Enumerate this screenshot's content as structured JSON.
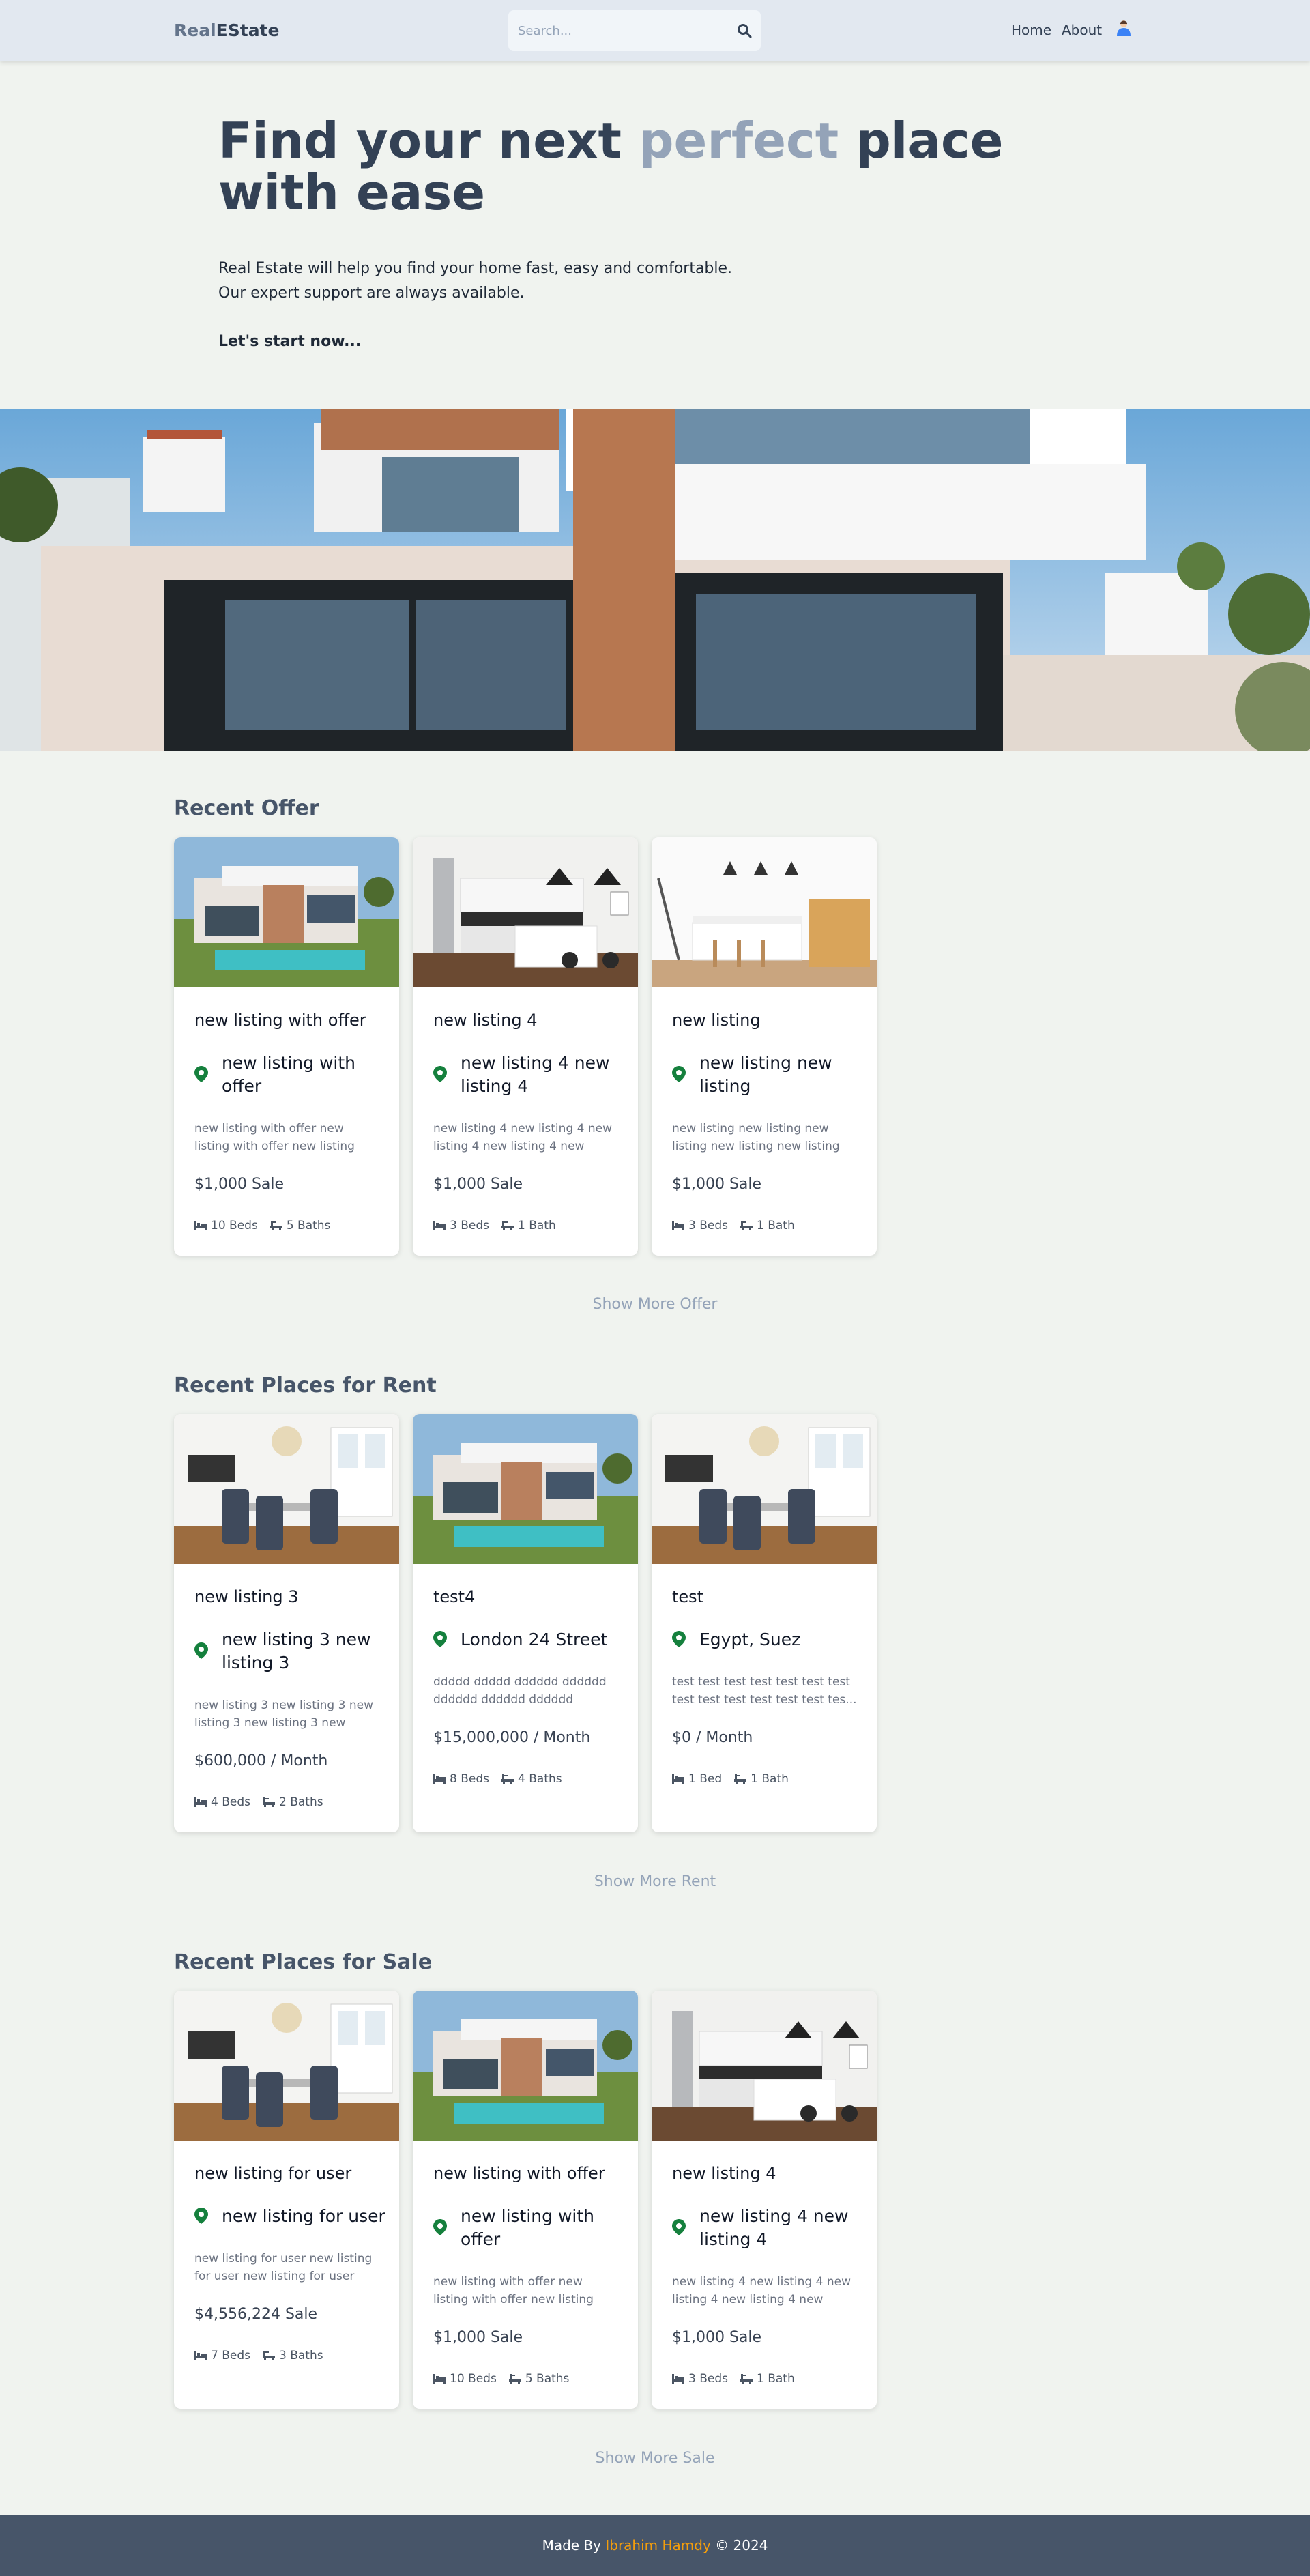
{
  "header": {
    "logo_part1": "Real",
    "logo_part2": "EState",
    "search_placeholder": "Search...",
    "nav": {
      "home": "Home",
      "about": "About"
    }
  },
  "hero": {
    "title_before": "Find your next ",
    "title_highlight": "perfect",
    "title_after": " place with ease",
    "desc_line1": "Real Estate will help you find your home fast, easy and comfortable.",
    "desc_line2": "Our expert support are always available.",
    "cta": "Let's start now..."
  },
  "sections": {
    "offer": {
      "title": "Recent Offer",
      "show_more": "Show More Offer",
      "cards": [
        {
          "title": "new listing with offer",
          "location": "new listing with offer",
          "desc": "new listing with offer new listing with offer new listing with offer...",
          "price": "$1,000 Sale",
          "beds": "10 Beds",
          "baths": "5 Baths",
          "image": "modern-house-pool"
        },
        {
          "title": "new listing 4",
          "location": "new listing 4 new listing 4",
          "desc": "new listing 4 new listing 4 new listing 4 new listing 4 new listing ...",
          "price": "$1,000 Sale",
          "beds": "3 Beds",
          "baths": "1 Bath",
          "image": "white-kitchen"
        },
        {
          "title": "new listing",
          "location": "new listing new listing",
          "desc": "new listing new listing new listing new listing new listing new listin...",
          "price": "$1,000 Sale",
          "beds": "3 Beds",
          "baths": "1 Bath",
          "image": "kitchen-island"
        }
      ]
    },
    "rent": {
      "title": "Recent Places for Rent",
      "show_more": "Show More Rent",
      "cards": [
        {
          "title": "new listing 3",
          "location": "new listing 3 new listing 3",
          "desc": "new listing 3 new listing 3 new listing 3 new listing 3 new listing ...",
          "price": "$600,000 / Month",
          "beds": "4 Beds",
          "baths": "2 Baths",
          "image": "dining-room"
        },
        {
          "title": "test4",
          "location": "London 24 Street",
          "desc": "ddddd ddddd dddddd dddddd dddddd dddddd dddddd ddddd...",
          "price": "$15,000,000 / Month",
          "beds": "8 Beds",
          "baths": "4 Baths",
          "image": "modern-house-pool"
        },
        {
          "title": "test",
          "location": "Egypt, Suez",
          "desc": "test test test test test test test test test test test test test tes...",
          "price": "$0 / Month",
          "beds": "1 Bed",
          "baths": "1 Bath",
          "image": "dining-room"
        }
      ]
    },
    "sale": {
      "title": "Recent Places for Sale",
      "show_more": "Show More Sale",
      "cards": [
        {
          "title": "new listing for user",
          "location": "new listing for user",
          "desc": "new listing for user new listing for user new listing for user new...",
          "price": "$4,556,224 Sale",
          "beds": "7 Beds",
          "baths": "3 Baths",
          "image": "dining-room"
        },
        {
          "title": "new listing with offer",
          "location": "new listing with offer",
          "desc": "new listing with offer new listing with offer new listing with offer...",
          "price": "$1,000 Sale",
          "beds": "10 Beds",
          "baths": "5 Baths",
          "image": "modern-house-pool"
        },
        {
          "title": "new listing 4",
          "location": "new listing 4 new listing 4",
          "desc": "new listing 4 new listing 4 new listing 4 new listing 4 new listing ...",
          "price": "$1,000 Sale",
          "beds": "3 Beds",
          "baths": "1 Bath",
          "image": "white-kitchen"
        }
      ]
    }
  },
  "footer": {
    "made_by": "Made By ",
    "author": "Ibrahim Hamdy",
    "copyright": " © 2024"
  },
  "colors": {
    "accent_pin": "#15803d",
    "footer_bg": "#475569",
    "author": "#f59e0b",
    "page_bg": "#f0f3ef"
  }
}
